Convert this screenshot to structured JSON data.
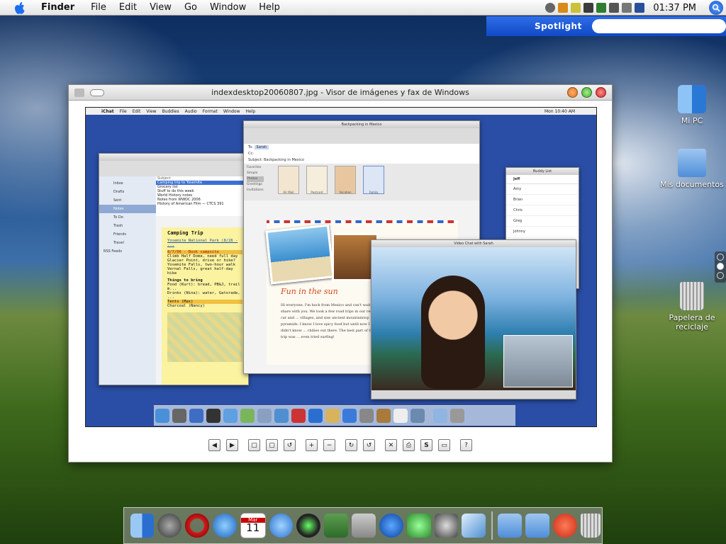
{
  "menubar": {
    "app": "Finder",
    "items": [
      "File",
      "Edit",
      "View",
      "Go",
      "Window",
      "Help"
    ],
    "clock": "01:37 PM"
  },
  "spotlight": {
    "label": "Spotlight",
    "query": ""
  },
  "desktop_icons": [
    {
      "label": "Mi PC"
    },
    {
      "label": "Mis documentos"
    },
    {
      "label": "Papelera de reciclaje"
    }
  ],
  "viewer": {
    "title": "indexdesktop20060807.jpg - Visor de imágenes y fax de Windows",
    "toolbar": [
      "◀",
      "▶",
      "▢",
      "▢",
      "↺",
      "+",
      "−",
      "↻",
      "↺",
      "✕",
      "⎙",
      "S",
      "▭",
      "?"
    ]
  },
  "inner": {
    "menubar": [
      "iChat",
      "File",
      "Edit",
      "View",
      "Buddies",
      "Audio",
      "Format",
      "Window",
      "Help"
    ],
    "menubar_clock": "Mon 10:40 AM",
    "mail_title": "Backpacking in Mexico",
    "mail_to": "Sarah",
    "mail_subject": "Backpacking in Mexico",
    "mail_heading": "Fun in the sun",
    "mail_body": "Hi everyone. I'm back from Mexico and can't wait to share with you. We took a few road trips in our rented car and ... villages, and saw ancient mountaintop pyramids. I know I love spicy food but until now I didn't know ... chilies out there. The best part of the trip was ... even tried surfing!",
    "video_title": "Video Chat with Sarah",
    "buddy_title": "Buddy List",
    "buddies": [
      "Jeff",
      "Amy",
      "Brian",
      "Chris",
      "Greg",
      "Johnny"
    ],
    "notes_title": "Camping Trip",
    "notes_lines": [
      "Yosemite National Park (8/26 - ...",
      "8/7/06 - Book campsite",
      "Climb Half Dome, need full day",
      "Glacier Point, drive or hike?",
      "Yosemite Falls, two-hour walk",
      "Vernal Falls, great half-day hike",
      "Things to bring",
      "Food (Kurt): bread, PB&J, trail m...",
      "Drinks (Nina): water, Gatorade, ...",
      "Tents (Max)",
      "Charcoal (Nancy)"
    ],
    "mail_list": [
      "Subject",
      "Camping trip to Yosemite",
      "Grocery list",
      "Stuff to do this week",
      "World History notes",
      "Notes from WWDC 2006",
      "History of American Film — CTCS 391"
    ],
    "mail_folders": [
      "Inbox",
      "Drafts",
      "Sent",
      "Notes",
      "To Do",
      "Trash",
      "Friends",
      "Travel",
      "RSS Feeds"
    ],
    "stationery": [
      "Favorites",
      "Simple",
      "Photos",
      "Greetings",
      "Invitations"
    ],
    "stationery_thumbs": [
      "Air Mail",
      "Postcard",
      "Vacation",
      "Family"
    ]
  },
  "dock_items": [
    "finder",
    "time-machine",
    "opera",
    "safari",
    "ical",
    "ichat",
    "itunes",
    "iphoto",
    "utilities",
    "motorola",
    "audio",
    "search",
    "boxes",
    "apps-folder",
    "music-folder",
    "quit",
    "trash"
  ],
  "ical_date": {
    "month": "Mar",
    "day": "11"
  }
}
